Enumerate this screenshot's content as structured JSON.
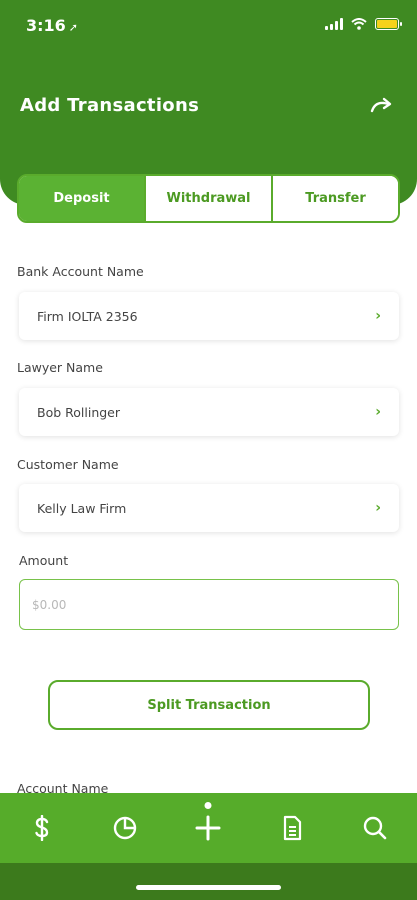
{
  "status_bar": {
    "time": "3:16",
    "location_arrow": "location-arrow-icon"
  },
  "header": {
    "title": "Add Transactions",
    "action_icon": "redo-icon"
  },
  "tabs": [
    {
      "label": "Deposit",
      "active": true
    },
    {
      "label": "Withdrawal",
      "active": false
    },
    {
      "label": "Transfer",
      "active": false
    }
  ],
  "form": {
    "bank_account": {
      "label": "Bank Account Name",
      "value": "Firm IOLTA 2356"
    },
    "lawyer": {
      "label": "Lawyer Name",
      "value": "Bob Rollinger"
    },
    "customer": {
      "label": "Customer Name",
      "value": "Kelly Law Firm"
    },
    "amount": {
      "label": "Amount",
      "placeholder": "$0.00",
      "value": ""
    },
    "split_button": "Split Transaction",
    "account_name": {
      "label": "Account Name"
    }
  },
  "bottom_nav": [
    {
      "icon": "dollar-icon"
    },
    {
      "icon": "pie-chart-icon"
    },
    {
      "icon": "add-icon",
      "active": true
    },
    {
      "icon": "document-icon"
    },
    {
      "icon": "search-icon"
    }
  ],
  "colors": {
    "header": "#3f8a22",
    "accent": "#5bb233",
    "nav": "#56ac2a"
  }
}
